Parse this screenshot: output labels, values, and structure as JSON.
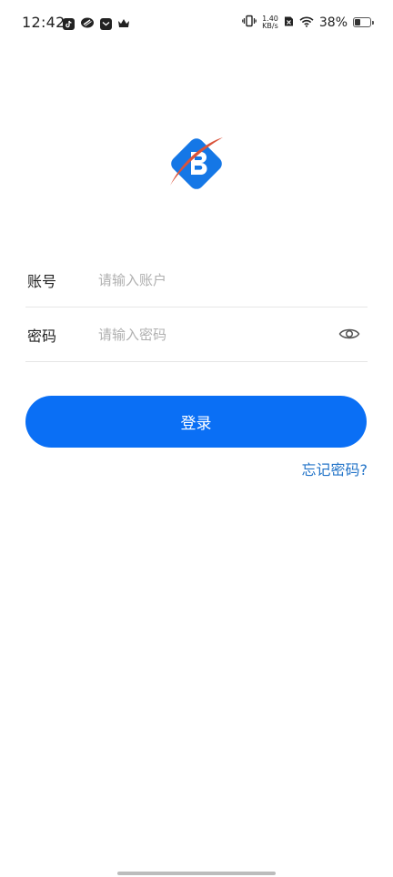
{
  "status_bar": {
    "time": "12:42",
    "net_speed_value": "1.40",
    "net_speed_unit": "KB/s",
    "battery_percent": "38%",
    "battery_level": 0.38
  },
  "login": {
    "account_label": "账号",
    "account_placeholder": "请输入账户",
    "password_label": "密码",
    "password_placeholder": "请输入密码",
    "login_button": "登录",
    "forgot_password": "忘记密码?"
  },
  "colors": {
    "primary": "#0a6ff5",
    "link": "#2374c8",
    "logo_blue": "#1577e6",
    "logo_red": "#d9533b"
  }
}
